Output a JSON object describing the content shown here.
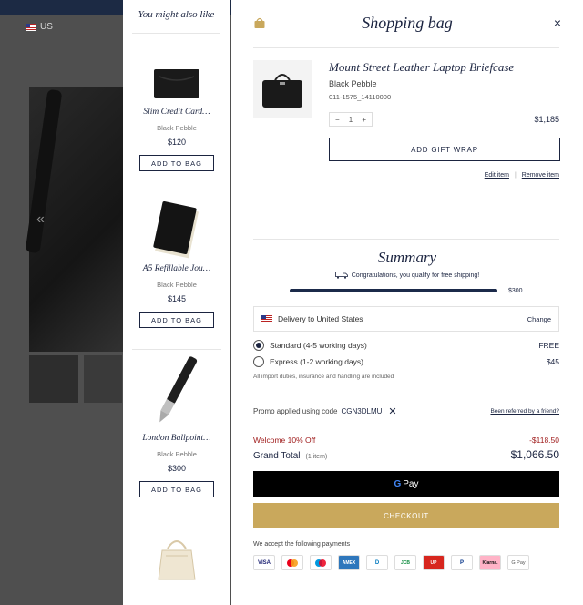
{
  "background": {
    "region_label": "US"
  },
  "recommendations": {
    "title": "You might also like",
    "items": [
      {
        "name": "Slim Credit Card…",
        "color": "Black Pebble",
        "price": "$120",
        "button": "ADD TO BAG"
      },
      {
        "name": "A5 Refillable Jou…",
        "color": "Black Pebble",
        "price": "$145",
        "button": "ADD TO BAG"
      },
      {
        "name": "London Ballpoint…",
        "color": "Black Pebble",
        "price": "$300",
        "button": "ADD TO BAG"
      }
    ]
  },
  "bag": {
    "title": "Shopping bag",
    "close_icon": "×",
    "item": {
      "name": "Mount Street Leather Laptop Briefcase",
      "color": "Black Pebble",
      "sku": "011-1575_14110000",
      "qty_minus": "−",
      "qty": "1",
      "qty_plus": "+",
      "price": "$1,185",
      "gift_wrap": "ADD GIFT WRAP",
      "edit": "Edit item",
      "separator": "|",
      "remove": "Remove item"
    },
    "summary": {
      "title": "Summary",
      "shipping_message": "Congratulations, you qualify for free shipping!",
      "progress_fraction": 1.0,
      "progress_label": "$300",
      "delivery_label": "Delivery to United States",
      "change": "Change",
      "options": [
        {
          "label": "Standard (4-5 working days)",
          "price": "FREE",
          "selected": true
        },
        {
          "label": "Express (1-2 working days)",
          "price": "$45",
          "selected": false
        }
      ],
      "import_note": "All import duties, insurance and handling are included",
      "promo_prefix": "Promo applied using code",
      "promo_code": "CGN3DLMU",
      "promo_remove": "✕",
      "referral": "Been referred by a friend?",
      "discount_label": "Welcome 10% Off",
      "discount_value": "-$118.50",
      "grand_label": "Grand Total",
      "grand_count": "(1 item)",
      "grand_value": "$1,066.50",
      "gpay_g": "G",
      "gpay_label": "Pay",
      "checkout": "CHECKOUT",
      "payments_label": "We accept the following payments",
      "cards": [
        "VISA",
        "●●",
        "●●",
        "AMEX",
        "D",
        "JCB",
        "UP",
        "P",
        "Klarna.",
        "G Pay"
      ]
    }
  },
  "colors": {
    "navy": "#1b2440",
    "gold": "#c9a85c",
    "discount_red": "#a12020"
  }
}
